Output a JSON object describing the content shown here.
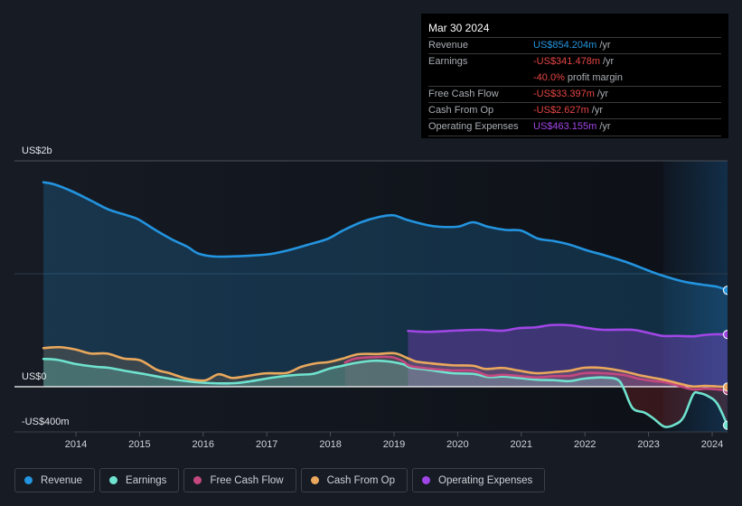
{
  "tooltip": {
    "date": "Mar 30 2024",
    "rows": [
      {
        "label": "Revenue",
        "value": "US$854.204m",
        "suffix": "/yr",
        "color": "#2394df"
      },
      {
        "label": "Earnings",
        "value": "-US$341.478m",
        "suffix": "/yr",
        "color": "#e64545",
        "sub_value": "-40.0%",
        "sub_suffix": "profit margin"
      },
      {
        "label": "Free Cash Flow",
        "value": "-US$33.397m",
        "suffix": "/yr",
        "color": "#e64545"
      },
      {
        "label": "Cash From Op",
        "value": "-US$2.627m",
        "suffix": "/yr",
        "color": "#e64545"
      },
      {
        "label": "Operating Expenses",
        "value": "US$463.155m",
        "suffix": "/yr",
        "color": "#a146e6"
      }
    ]
  },
  "legend": {
    "items": [
      {
        "label": "Revenue",
        "color": "#2394df"
      },
      {
        "label": "Earnings",
        "color": "#6fe3cf"
      },
      {
        "label": "Free Cash Flow",
        "color": "#c4487f"
      },
      {
        "label": "Cash From Op",
        "color": "#eaa85c"
      },
      {
        "label": "Operating Expenses",
        "color": "#a146e6"
      }
    ]
  },
  "chart_data": {
    "type": "area",
    "title": "",
    "xlabel": "",
    "ylabel": "",
    "unit": "US$ millions",
    "xlim": [
      2013.49,
      2024.24
    ],
    "ylim": [
      -400,
      2000
    ],
    "grid": true,
    "legend_position": "bottom",
    "highlight_range": [
      2023.23,
      2024.24
    ],
    "x_ticks": [
      {
        "value": 2014,
        "label": "2014"
      },
      {
        "value": 2015,
        "label": "2015"
      },
      {
        "value": 2016,
        "label": "2016"
      },
      {
        "value": 2017,
        "label": "2017"
      },
      {
        "value": 2018,
        "label": "2018"
      },
      {
        "value": 2019,
        "label": "2019"
      },
      {
        "value": 2020,
        "label": "2020"
      },
      {
        "value": 2021,
        "label": "2021"
      },
      {
        "value": 2022,
        "label": "2022"
      },
      {
        "value": 2023,
        "label": "2023"
      },
      {
        "value": 2024,
        "label": "2024"
      }
    ],
    "y_ticks": [
      {
        "value": 2000,
        "label": "US$2b"
      },
      {
        "value": 1000,
        "label": ""
      },
      {
        "value": 0,
        "label": "US$0"
      },
      {
        "value": -400,
        "label": "-US$400m"
      }
    ],
    "series": [
      {
        "key": "revenue",
        "name": "Revenue",
        "color": "#2394df",
        "fill_opacity": 0.22,
        "points": [
          [
            2013.49,
            1810
          ],
          [
            2013.66,
            1792
          ],
          [
            2013.94,
            1730
          ],
          [
            2014.23,
            1650
          ],
          [
            2014.51,
            1570
          ],
          [
            2014.8,
            1518
          ],
          [
            2014.98,
            1482
          ],
          [
            2015.26,
            1384
          ],
          [
            2015.51,
            1304
          ],
          [
            2015.75,
            1240
          ],
          [
            2015.93,
            1178
          ],
          [
            2016.22,
            1152
          ],
          [
            2016.78,
            1162
          ],
          [
            2017.07,
            1176
          ],
          [
            2017.35,
            1210
          ],
          [
            2017.64,
            1256
          ],
          [
            2017.96,
            1310
          ],
          [
            2018.2,
            1384
          ],
          [
            2018.49,
            1458
          ],
          [
            2018.77,
            1504
          ],
          [
            2018.99,
            1518
          ],
          [
            2019.2,
            1478
          ],
          [
            2019.53,
            1430
          ],
          [
            2019.72,
            1416
          ],
          [
            2020.01,
            1418
          ],
          [
            2020.24,
            1456
          ],
          [
            2020.48,
            1416
          ],
          [
            2020.76,
            1388
          ],
          [
            2021.0,
            1382
          ],
          [
            2021.26,
            1312
          ],
          [
            2021.51,
            1290
          ],
          [
            2021.76,
            1258
          ],
          [
            2022.04,
            1206
          ],
          [
            2022.32,
            1162
          ],
          [
            2022.65,
            1104
          ],
          [
            2022.99,
            1030
          ],
          [
            2023.22,
            984
          ],
          [
            2023.56,
            930
          ],
          [
            2023.84,
            904
          ],
          [
            2024.07,
            886
          ],
          [
            2024.24,
            854.204
          ]
        ]
      },
      {
        "key": "operating-expenses",
        "name": "Operating Expenses",
        "color": "#a146e6",
        "fill_opacity": 0.3,
        "points": [
          [
            2019.22,
            494
          ],
          [
            2019.53,
            486
          ],
          [
            2020.0,
            498
          ],
          [
            2020.38,
            504
          ],
          [
            2020.71,
            496
          ],
          [
            2020.95,
            518
          ],
          [
            2021.23,
            526
          ],
          [
            2021.47,
            546
          ],
          [
            2021.76,
            544
          ],
          [
            2022.04,
            520
          ],
          [
            2022.28,
            504
          ],
          [
            2022.75,
            504
          ],
          [
            2022.99,
            478
          ],
          [
            2023.22,
            450
          ],
          [
            2023.46,
            450
          ],
          [
            2023.7,
            446
          ],
          [
            2023.84,
            456
          ],
          [
            2024.03,
            464
          ],
          [
            2024.24,
            463.155
          ]
        ]
      },
      {
        "key": "cash-from-op",
        "name": "Cash From Op",
        "color": "#eaa85c",
        "fill_opacity": 0.16,
        "points": [
          [
            2013.49,
            342
          ],
          [
            2013.75,
            350
          ],
          [
            2013.99,
            330
          ],
          [
            2014.23,
            294
          ],
          [
            2014.49,
            294
          ],
          [
            2014.75,
            250
          ],
          [
            2015.01,
            234
          ],
          [
            2015.27,
            150
          ],
          [
            2015.46,
            122
          ],
          [
            2015.74,
            72
          ],
          [
            2016.03,
            56
          ],
          [
            2016.24,
            110
          ],
          [
            2016.45,
            78
          ],
          [
            2016.64,
            90
          ],
          [
            2016.97,
            118
          ],
          [
            2017.31,
            122
          ],
          [
            2017.54,
            176
          ],
          [
            2017.78,
            208
          ],
          [
            2017.97,
            218
          ],
          [
            2018.2,
            250
          ],
          [
            2018.44,
            288
          ],
          [
            2018.73,
            290
          ],
          [
            2019.01,
            296
          ],
          [
            2019.2,
            256
          ],
          [
            2019.34,
            224
          ],
          [
            2019.53,
            210
          ],
          [
            2019.91,
            190
          ],
          [
            2020.24,
            186
          ],
          [
            2020.43,
            158
          ],
          [
            2020.71,
            166
          ],
          [
            2020.95,
            144
          ],
          [
            2021.23,
            120
          ],
          [
            2021.52,
            130
          ],
          [
            2021.76,
            142
          ],
          [
            2021.99,
            168
          ],
          [
            2022.28,
            166
          ],
          [
            2022.61,
            136
          ],
          [
            2022.84,
            104
          ],
          [
            2023.08,
            78
          ],
          [
            2023.27,
            58
          ],
          [
            2023.51,
            24
          ],
          [
            2023.7,
            2
          ],
          [
            2023.89,
            8
          ],
          [
            2024.08,
            2
          ],
          [
            2024.24,
            -2.627
          ]
        ]
      },
      {
        "key": "free-cash-flow",
        "name": "Free Cash Flow",
        "color": "#c4487f",
        "fill_opacity": 0.16,
        "points": [
          [
            2018.23,
            214
          ],
          [
            2018.39,
            250
          ],
          [
            2018.68,
            262
          ],
          [
            2018.96,
            262
          ],
          [
            2019.15,
            224
          ],
          [
            2019.25,
            184
          ],
          [
            2019.53,
            162
          ],
          [
            2019.91,
            144
          ],
          [
            2020.24,
            142
          ],
          [
            2020.48,
            98
          ],
          [
            2020.71,
            106
          ],
          [
            2020.95,
            96
          ],
          [
            2021.23,
            82
          ],
          [
            2021.52,
            94
          ],
          [
            2021.76,
            96
          ],
          [
            2021.99,
            120
          ],
          [
            2022.28,
            120
          ],
          [
            2022.61,
            104
          ],
          [
            2022.84,
            72
          ],
          [
            2023.08,
            50
          ],
          [
            2023.27,
            38
          ],
          [
            2023.51,
            2
          ],
          [
            2023.7,
            -24
          ],
          [
            2023.89,
            -18
          ],
          [
            2024.08,
            -24
          ],
          [
            2024.24,
            -33.397
          ]
        ]
      },
      {
        "key": "earnings",
        "name": "Earnings",
        "color": "#6fe3cf",
        "fill_opacity": 0.26,
        "negative_fill": "#c83232",
        "points": [
          [
            2013.49,
            246
          ],
          [
            2013.71,
            238
          ],
          [
            2013.99,
            202
          ],
          [
            2014.32,
            176
          ],
          [
            2014.51,
            168
          ],
          [
            2014.8,
            138
          ],
          [
            2015.08,
            112
          ],
          [
            2015.36,
            82
          ],
          [
            2015.65,
            56
          ],
          [
            2015.93,
            38
          ],
          [
            2016.22,
            30
          ],
          [
            2016.5,
            32
          ],
          [
            2016.74,
            48
          ],
          [
            2016.97,
            70
          ],
          [
            2017.21,
            90
          ],
          [
            2017.49,
            106
          ],
          [
            2017.73,
            114
          ],
          [
            2017.97,
            158
          ],
          [
            2018.16,
            182
          ],
          [
            2018.39,
            210
          ],
          [
            2018.68,
            230
          ],
          [
            2018.91,
            224
          ],
          [
            2019.15,
            198
          ],
          [
            2019.25,
            170
          ],
          [
            2019.53,
            150
          ],
          [
            2019.91,
            120
          ],
          [
            2020.24,
            114
          ],
          [
            2020.48,
            86
          ],
          [
            2020.71,
            90
          ],
          [
            2020.95,
            78
          ],
          [
            2021.23,
            62
          ],
          [
            2021.52,
            58
          ],
          [
            2021.76,
            50
          ],
          [
            2021.99,
            72
          ],
          [
            2022.28,
            82
          ],
          [
            2022.51,
            64
          ],
          [
            2022.61,
            -16
          ],
          [
            2022.75,
            -190
          ],
          [
            2022.94,
            -230
          ],
          [
            2023.08,
            -282
          ],
          [
            2023.25,
            -354
          ],
          [
            2023.41,
            -336
          ],
          [
            2023.55,
            -270
          ],
          [
            2023.7,
            -70
          ],
          [
            2023.79,
            -56
          ],
          [
            2023.93,
            -82
          ],
          [
            2024.08,
            -150
          ],
          [
            2024.24,
            -341.478
          ]
        ]
      }
    ]
  }
}
